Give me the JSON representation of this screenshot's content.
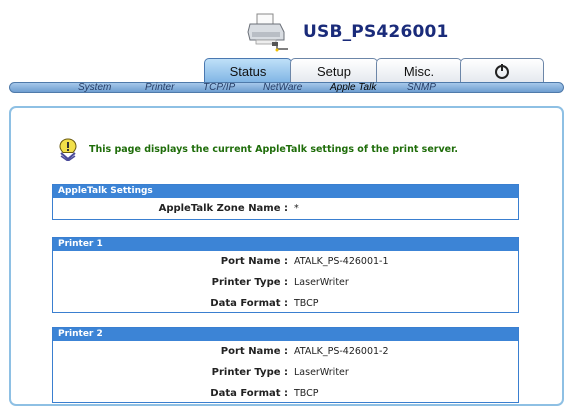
{
  "header": {
    "device_name": "USB_PS426001"
  },
  "tabs": [
    {
      "label": "Status",
      "active": true
    },
    {
      "label": "Setup",
      "active": false
    },
    {
      "label": "Misc.",
      "active": false
    },
    {
      "icon": "power-icon",
      "active": false
    }
  ],
  "subnav": [
    {
      "label": "System",
      "active": false
    },
    {
      "label": "Printer",
      "active": false
    },
    {
      "label": "TCP/IP",
      "active": false
    },
    {
      "label": "NetWare",
      "active": false
    },
    {
      "label": "Apple Talk",
      "active": true
    },
    {
      "label": "SNMP",
      "active": false
    }
  ],
  "intro_text": "This page displays the current AppleTalk settings of the print server.",
  "appletalk_settings": {
    "title": "AppleTalk Settings",
    "zone_label": "AppleTalk Zone Name :",
    "zone_value": "*"
  },
  "printers": [
    {
      "title": "Printer 1",
      "port_label": "Port Name :",
      "port_value": "ATALK_PS-426001-1",
      "type_label": "Printer Type :",
      "type_value": "LaserWriter",
      "format_label": "Data Format :",
      "format_value": "TBCP"
    },
    {
      "title": "Printer 2",
      "port_label": "Port Name :",
      "port_value": "ATALK_PS-426001-2",
      "type_label": "Printer Type :",
      "type_value": "LaserWriter",
      "format_label": "Data Format :",
      "format_value": "TBCP"
    }
  ],
  "colors": {
    "panel_title_bg": "#3c84d6",
    "intro_text": "#1f6d0a",
    "device_name": "#1a2b7a"
  }
}
